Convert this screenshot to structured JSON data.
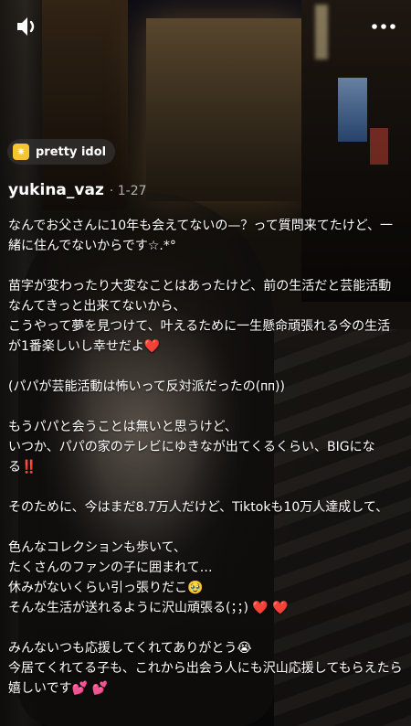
{
  "tag": {
    "icon": "sparkle-icon",
    "label": "pretty idol"
  },
  "author": {
    "username": "yukina_vaz",
    "date": "1-27"
  },
  "caption": [
    "なんでお父さんに10年も会えてないの—？って質問来てたけど、一緒に住んでないからです☆.*°",
    "",
    "苗字が変わったり大変なことはあったけど、前の生活だと芸能活動なんてきっと出来てないから、",
    "こうやって夢を見つけて、叶えるために一生懸命頑張れる今の生活が1番楽しいし幸せだよ❤️",
    "",
    "(パパが芸能活動は怖いって反対派だったの(ᴨᴨ))",
    "",
    "もうパパと会うことは無いと思うけど、",
    "いつか、パパの家のテレビにゆきなが出てくるくらい、BIGになる‼️",
    "",
    "そのために、今はまだ8.7万人だけど、Tiktokも10万人達成して、",
    "",
    "色んなコレクションも歩いて、",
    "たくさんのファンの子に囲まれて…",
    "休みがないくらい引っ張りだこ🥹",
    "そんな生活が送れるように沢山頑張る(；；) ❤️ ❤️",
    "",
    "みんないつも応援してくれてありがとう😭",
    "今居てくれてる子も、これから出会う人にも沢山応援してもらえたら嬉しいです💕 💕"
  ]
}
